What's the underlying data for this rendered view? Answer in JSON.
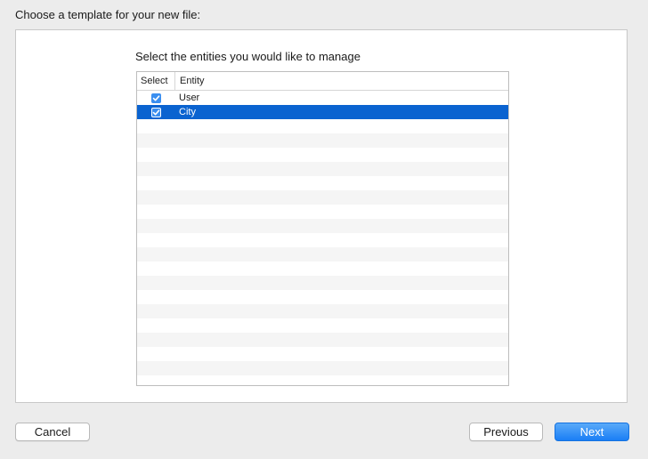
{
  "dialog": {
    "title": "Choose a template for your new file:"
  },
  "panel": {
    "prompt": "Select the entities you would like to manage",
    "table": {
      "columns": [
        "Select",
        "Entity"
      ],
      "rows": [
        {
          "entity": "User",
          "checked": true,
          "selected": false
        },
        {
          "entity": "City",
          "checked": true,
          "selected": true
        }
      ]
    }
  },
  "buttons": {
    "cancel": "Cancel",
    "previous": "Previous",
    "next": "Next"
  },
  "colors": {
    "selection": "#0a63d0",
    "checkbox": "#3b8ff0",
    "primary_button": "#1a7ef5"
  }
}
